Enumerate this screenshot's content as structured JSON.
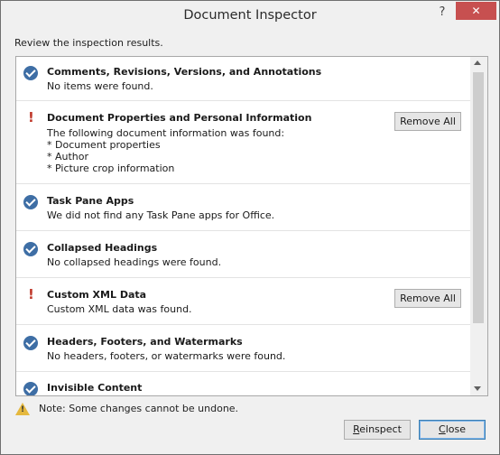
{
  "window": {
    "title": "Document Inspector",
    "help_glyph": "?",
    "close_glyph": "✕"
  },
  "instruction": "Review the inspection results.",
  "results": [
    {
      "status": "ok",
      "title": "Comments, Revisions, Versions, and Annotations",
      "description": [
        "No items were found."
      ]
    },
    {
      "status": "warning",
      "title": "Document Properties and Personal Information",
      "description": [
        "The following document information was found:",
        "* Document properties",
        "* Author",
        "* Picture crop information"
      ],
      "action": "Remove All"
    },
    {
      "status": "ok",
      "title": "Task Pane Apps",
      "description": [
        "We did not find any Task Pane apps for Office."
      ]
    },
    {
      "status": "ok",
      "title": "Collapsed Headings",
      "description": [
        "No collapsed headings were found."
      ]
    },
    {
      "status": "warning",
      "title": "Custom XML Data",
      "description": [
        "Custom XML data was found."
      ],
      "action": "Remove All"
    },
    {
      "status": "ok",
      "title": "Headers, Footers, and Watermarks",
      "description": [
        "No headers, footers, or watermarks were found."
      ]
    },
    {
      "status": "ok",
      "title": "Invisible Content",
      "description": []
    }
  ],
  "note": "Note: Some changes cannot be undone.",
  "buttons": {
    "reinspect": {
      "mnemonic": "R",
      "rest": "einspect"
    },
    "close": {
      "mnemonic": "C",
      "rest": "lose"
    }
  }
}
